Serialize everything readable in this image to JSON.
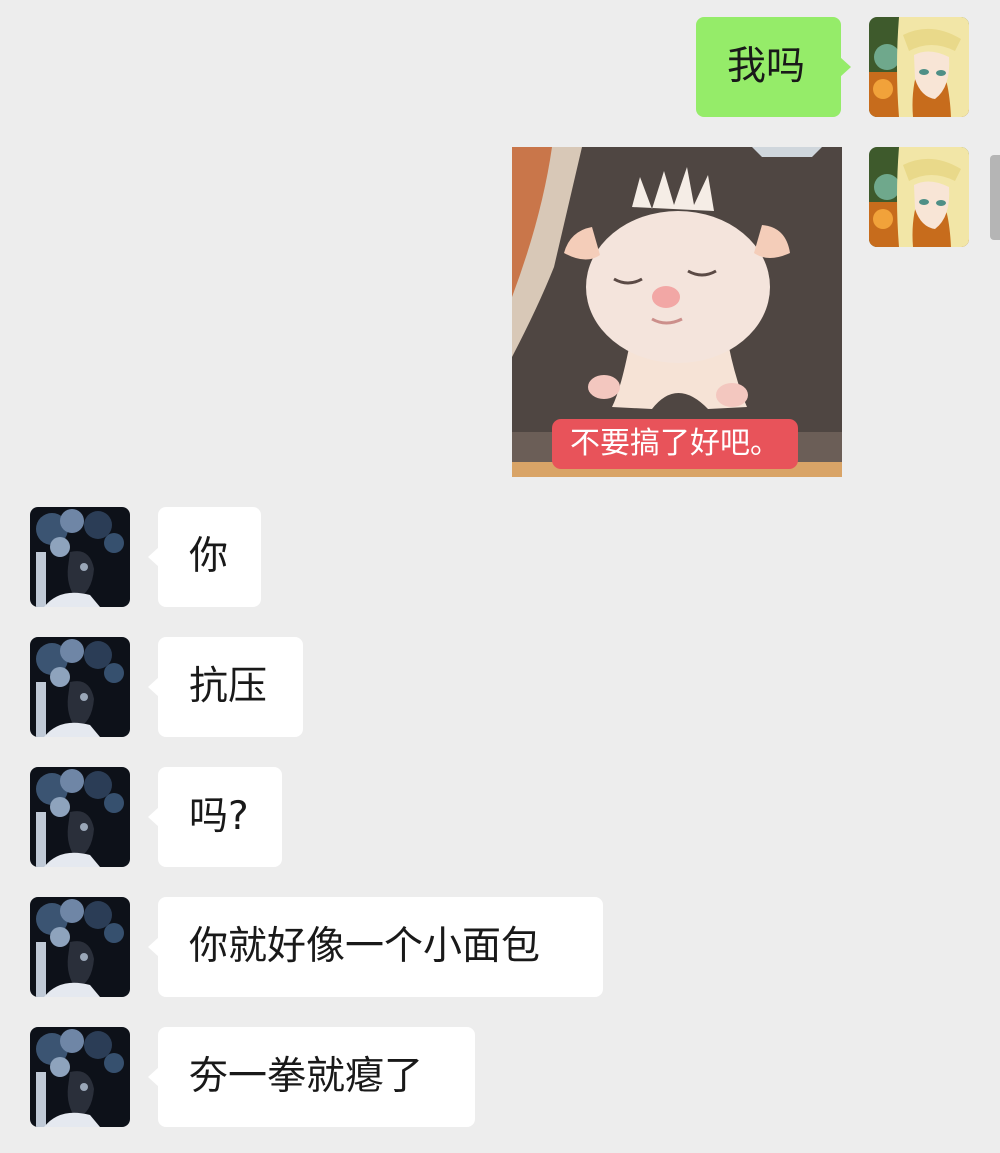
{
  "messages": [
    {
      "side": "out",
      "type": "text",
      "text": "我吗"
    },
    {
      "side": "out",
      "type": "sticker",
      "caption": "不要搞了好吧。"
    },
    {
      "side": "in",
      "type": "text",
      "text": "你"
    },
    {
      "side": "in",
      "type": "text",
      "text": "抗压"
    },
    {
      "side": "in",
      "type": "text",
      "text": "吗?"
    },
    {
      "side": "in",
      "type": "text",
      "text": "你就好像一个小面包"
    },
    {
      "side": "in",
      "type": "text",
      "text": "夯一拳就瘪了"
    }
  ],
  "colors": {
    "background": "#ededed",
    "outgoing_bubble": "#95ec69",
    "incoming_bubble": "#ffffff",
    "sticker_caption": "#e8535a"
  },
  "icons": {
    "self_avatar": "anime-girl-avatar",
    "contact_avatar": "dark-portrait-avatar",
    "sticker": "kitten-sticker"
  }
}
